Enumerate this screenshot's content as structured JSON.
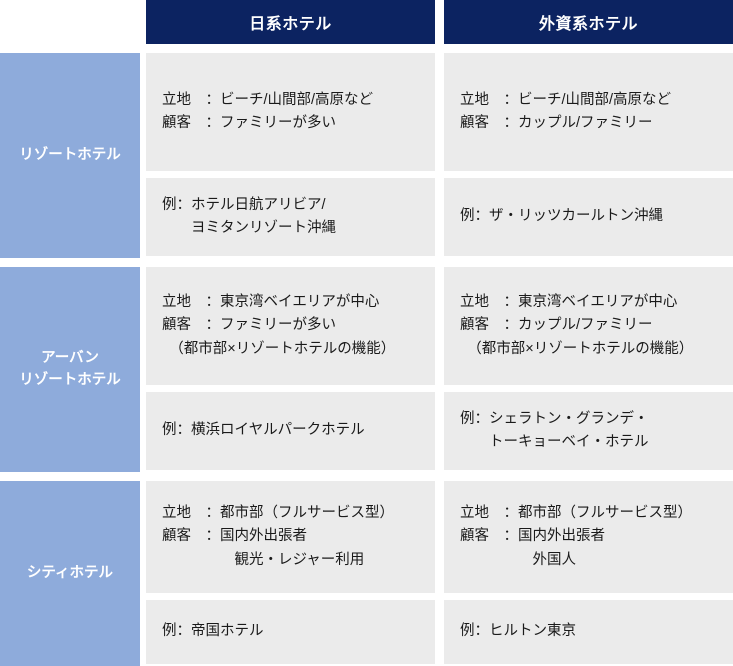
{
  "table": {
    "corner_label": "",
    "columns": [
      {
        "id": "domestic",
        "header": "日系ホテル"
      },
      {
        "id": "foreign",
        "header": "外資系ホテル"
      }
    ],
    "colors": {
      "header_bg": "#0c2361",
      "header_text": "#ffffff",
      "row_label_bg": "#8eabdb",
      "row_label_text": "#ffffff",
      "cell_bg": "#ebebeb",
      "cell_text": "#1a1a1a",
      "page_bg": "#ffffff"
    },
    "rows": [
      {
        "id": "resort",
        "label": "リゾートホテル",
        "label_lines": [
          "リゾートホテル"
        ],
        "attributes": {
          "domestic": [
            "立地　：ビーチ/山間部/高原など",
            "顧客　：ファミリーが多い"
          ],
          "foreign": [
            "立地　：ビーチ/山間部/高原など",
            "顧客　：カップル/ファミリー"
          ]
        },
        "examples": {
          "domestic": [
            "例：ホテル日航アリビア/",
            "　　ヨミタンリゾート沖縄"
          ],
          "foreign": [
            "例：ザ・リッツカールトン沖縄"
          ]
        }
      },
      {
        "id": "urban-resort",
        "label": "アーバンリゾートホテル",
        "label_lines": [
          "アーバン",
          "リゾートホテル"
        ],
        "attributes": {
          "domestic": [
            "立地　：東京湾ベイエリアが中心",
            "顧客　：ファミリーが多い",
            "　（都市部×リゾートホテルの機能）"
          ],
          "foreign": [
            "立地　：東京湾ベイエリアが中心",
            "顧客　：カップル/ファミリー",
            "　（都市部×リゾートホテルの機能）"
          ]
        },
        "examples": {
          "domestic": [
            "例：横浜ロイヤルパークホテル"
          ],
          "foreign": [
            "例：シェラトン・グランデ・",
            "　　トーキョーベイ・ホテル"
          ]
        }
      },
      {
        "id": "city",
        "label": "シティホテル",
        "label_lines": [
          "シティホテル"
        ],
        "attributes": {
          "domestic": [
            "立地　：都市部（フルサービス型）",
            "顧客　：国内外出張者",
            "　　　　　観光・レジャー利用"
          ],
          "foreign": [
            "立地　：都市部（フルサービス型）",
            "顧客　：国内外出張者",
            "　　　　　外国人"
          ]
        },
        "examples": {
          "domestic": [
            "例：帝国ホテル"
          ],
          "foreign": [
            "例：ヒルトン東京"
          ]
        }
      }
    ]
  }
}
